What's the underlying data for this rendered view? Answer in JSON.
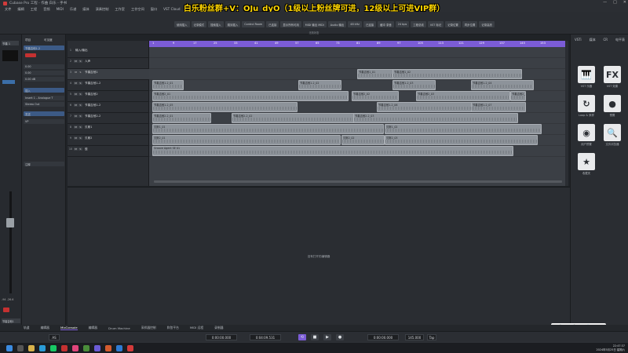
{
  "window": {
    "title": "Cubase Pro 工程 - 作曲 白乐 - 手书",
    "controls": [
      "—",
      "□",
      "✕"
    ]
  },
  "overlay": {
    "banner": "白乐粉丝群+V：OJu_dyO（1级以上粉丝牌可进，12级以上可进VIP群）"
  },
  "menubar": [
    "文件",
    "编辑",
    "工程",
    "音频",
    "MIDI",
    "乐谱",
    "媒体",
    "演奏控制",
    "工作室",
    "工作空间",
    "窗口",
    "VST Cloud",
    "Hub",
    "帮助"
  ],
  "toolbar": {
    "buttons": [
      "使用插入",
      "记录模式",
      "搜索插入",
      "跳到插入",
      "Control Room",
      "已连接",
      "显示所有可用",
      "MIDI 输出 MIDI",
      "Audio 输出",
      "48 kHz",
      "已连接",
      "缓冲 录音",
      "24 bps",
      "工程总线",
      "VST 标记",
      "记录位置",
      "同步位置",
      "记录高亮"
    ],
    "subtitle": "无效状态"
  },
  "inspector": {
    "track_label": "节奏 1",
    "tabs": [
      "项目",
      "可见度"
    ],
    "rows": [
      "节奏吉他1-2",
      "0.00",
      "0.00",
      "0.00 dB",
      "插入",
      "Insert 1 - Analogue T",
      "Stereo Out",
      "发送",
      "VP",
      "注释"
    ],
    "bottom_value": "-94 -26.6",
    "bottom_label": "节奏吉他1"
  },
  "tracks": [
    {
      "num": "1",
      "name": "输入/输出"
    },
    {
      "num": "2",
      "name": "人声"
    },
    {
      "num": "3",
      "name": "节奏吉他1"
    },
    {
      "num": "4",
      "name": "节奏吉他1-2"
    },
    {
      "num": "5",
      "name": "节奏吉他2"
    },
    {
      "num": "6",
      "name": "节奏吉他1-2"
    },
    {
      "num": "7",
      "name": "节奏吉他2-2"
    },
    {
      "num": "8",
      "name": "贝斯1"
    },
    {
      "num": "9",
      "name": "贝斯2"
    },
    {
      "num": "10",
      "name": "鼓"
    }
  ],
  "ruler": [
    "1",
    "9",
    "17",
    "25",
    "33",
    "41",
    "49",
    "57",
    "65",
    "73",
    "81",
    "89",
    "97",
    "105",
    "113",
    "121",
    "129",
    "137",
    "145",
    "153"
  ],
  "clips": [
    {
      "lane": 2,
      "label": "节奏吉他1_01"
    },
    {
      "lane": 2,
      "label": "节奏吉他1_02"
    },
    {
      "lane": 3,
      "label": "节奏吉他1-2_01"
    },
    {
      "lane": 3,
      "label": "节奏吉他1-2_02"
    },
    {
      "lane": 3,
      "label": "节奏吉他1-2_03"
    },
    {
      "lane": 3,
      "label": "节奏吉他1-2_04"
    },
    {
      "lane": 4,
      "label": "节奏吉他2_01"
    },
    {
      "lane": 4,
      "label": "节奏吉他2_02"
    },
    {
      "lane": 4,
      "label": "节奏吉他2_03"
    },
    {
      "lane": 4,
      "label": "节奏吉他2_04"
    },
    {
      "lane": 5,
      "label": "节奏吉他1-2_05"
    },
    {
      "lane": 5,
      "label": "节奏吉他1-2_06"
    },
    {
      "lane": 5,
      "label": "节奏吉他1-2_07"
    },
    {
      "lane": 6,
      "label": "节奏吉他2-2_01"
    },
    {
      "lane": 6,
      "label": "节奏吉他2-2_02"
    },
    {
      "lane": 6,
      "label": "节奏吉他2-2_03"
    },
    {
      "lane": 7,
      "label": "贝斯1_01"
    },
    {
      "lane": 7,
      "label": "贝斯1_02"
    },
    {
      "lane": 8,
      "label": "贝斯2_01"
    },
    {
      "lane": 8,
      "label": "贝斯2_02"
    },
    {
      "lane": 8,
      "label": "贝斯2_03"
    },
    {
      "lane": 9,
      "label": "Groove Agent SE 01"
    }
  ],
  "lower_zone": {
    "message": "没有打开的编辑器"
  },
  "right_panel": {
    "tabs": [
      "VSTi",
      "媒体",
      "CR",
      "电平表"
    ],
    "tiles": [
      {
        "glyph": "🎹",
        "label": "VST 乐器",
        "icon": "piano-icon"
      },
      {
        "glyph": "FX",
        "label": "VST 效果",
        "icon": "fx-icon"
      },
      {
        "glyph": "↻",
        "label": "Loop & 采样",
        "icon": "loop-icon"
      },
      {
        "glyph": "●",
        "label": "预置",
        "icon": "presets-icon"
      },
      {
        "glyph": "◉",
        "label": "用户预置",
        "icon": "user-presets-icon"
      },
      {
        "glyph": "🔍",
        "label": "文件浏览器",
        "icon": "file-browser-icon"
      },
      {
        "glyph": "★",
        "label": "收藏夹",
        "icon": "favorites-icon"
      }
    ]
  },
  "zone_tabs": [
    "轨道",
    "编辑器",
    "MixConsole",
    "编辑器",
    "Drum Machine",
    "采样器控制",
    "和弦平台",
    "MIDI 远程",
    "录制器"
  ],
  "transport": {
    "left_time": "0:00:00.000",
    "center_time": "0:04:09.531",
    "right_time": "0:00:00.000",
    "tempo": "145.000",
    "tap": "Tap",
    "marker": "AS"
  },
  "ime": [
    "S",
    "中",
    "•",
    "🎤",
    "▦",
    "👕",
    "⋯",
    "AI"
  ],
  "clock": {
    "time": "22:47:37",
    "date": "2024年5月25日 星期六"
  }
}
